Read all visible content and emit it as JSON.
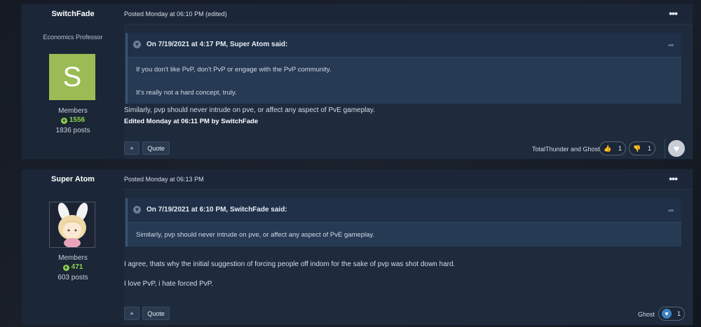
{
  "posts": [
    {
      "author": "SwitchFade",
      "member_title": "Economics Professor",
      "avatar_letter": "S",
      "group": "Members",
      "reputation": "1556",
      "post_count": "1836 posts",
      "posted": "Posted Monday at 06:10 PM (edited)",
      "more_label": "•••",
      "quote": {
        "cite": "On 7/19/2021 at 4:17 PM, Super Atom said:",
        "lines": [
          "If you don't like PvP, don't PvP or engage with the PvP community.",
          "It's really not a hard concept, truly."
        ]
      },
      "body": [
        "Similarly, pvp should never intrude on pve, or affect any aspect of PvE gameplay."
      ],
      "edited_note": "Edited Monday at 06:11 PM by SwitchFade",
      "actions": {
        "plus_label": "+",
        "quote_label": "Quote"
      },
      "reacted_by": "TotalThunder and Ghost",
      "reactions": [
        {
          "icon": "thumbs-up-icon",
          "glyph": "👍",
          "count": "1",
          "color": "#e0a528"
        },
        {
          "icon": "thumbs-down-icon",
          "glyph": "👎",
          "count": "1",
          "color": "#e0a528"
        }
      ],
      "heart_glyph": "♥"
    },
    {
      "author": "Super Atom",
      "group": "Members",
      "reputation": "471",
      "post_count": "603 posts",
      "posted": "Posted Monday at 06:13 PM",
      "more_label": "•••",
      "quote": {
        "cite": "On 7/19/2021 at 6:10 PM, SwitchFade said:",
        "lines": [
          "Similarly, pvp should never intrude on pve, or affect any aspect of PvE gameplay."
        ]
      },
      "body": [
        "I agree, thats why the initial suggestion of forcing people off indom for the sake of pvp was shot down hard.",
        "I love PvP, i hate forced PvP."
      ],
      "actions": {
        "plus_label": "+",
        "quote_label": "Quote"
      },
      "reacted_by": "Ghost",
      "reactions": [
        {
          "icon": "heart-icon",
          "glyph": "♥",
          "count": "1",
          "color": "#3b82c4"
        }
      ]
    }
  ],
  "colors": {
    "accent_green": "#8fd34a",
    "avatar_green": "#9bbc55",
    "panel": "#1e2b3d"
  }
}
